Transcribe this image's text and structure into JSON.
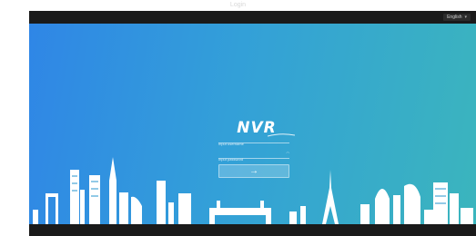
{
  "page": {
    "title": "Login"
  },
  "topbar": {
    "language": "English"
  },
  "brand": {
    "logo_text": "NVR"
  },
  "login": {
    "username_placeholder": "Input username",
    "password_placeholder": "Input password",
    "submit_symbol": "→",
    "password_toggle": "◠"
  },
  "colors": {
    "gradient_start": "#2f86e6",
    "gradient_end": "#3bb5bd",
    "bar": "#1a1a1a"
  }
}
